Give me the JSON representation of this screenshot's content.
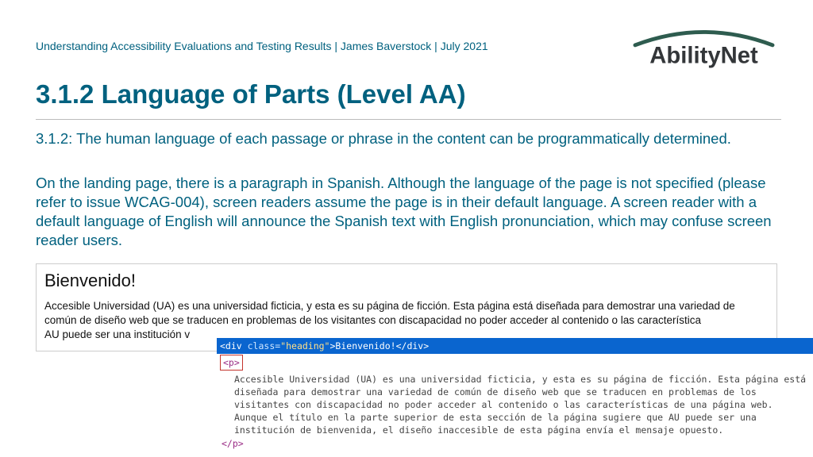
{
  "header": "Understanding Accessibility Evaluations and Testing Results | James Baverstock | July 2021",
  "logo_text": "AbilityNet",
  "title": "3.1.2 Language of Parts (Level AA)",
  "criterion": "3.1.2: The human language of each passage or phrase in the content can be programmatically determined.",
  "explanation": "On the landing page, there is a paragraph in Spanish. Although the language of the page is not specified (please refer to issue WCAG-004), screen readers assume the page is in their default language. A screen reader with a default language of English will announce the Spanish text with English pronunciation, which may confuse screen reader users.",
  "snippet": {
    "heading": "Bienvenido!",
    "para_before": "Accesible Universidad (UA) es una universidad ficticia, y esta es su página de ficción. Esta página está diseñada para demostrar una variedad de común de diseño web que se traducen en problemas de los visitantes con discapacidad no poder acceder al contenido o las característica",
    "para_tail": "AU puede ser una institución v"
  },
  "devtools": {
    "row1_raw": "<div class=\"heading\">Bienvenido!</div>",
    "p_open": "<p>",
    "body": "Accesible Universidad (UA) es una universidad ficticia, y esta es su página de ficción. Esta página está diseñada para demostrar una variedad de común de diseño web que se traducen en problemas de los visitantes con discapacidad no poder acceder al contenido o las características de una página web. Aunque el título en la parte superior de esta sección de la página sugiere que AU puede ser una institución de bienvenida, el diseño inaccesible de esta página envía el mensaje opuesto.",
    "p_close": "</p>"
  }
}
